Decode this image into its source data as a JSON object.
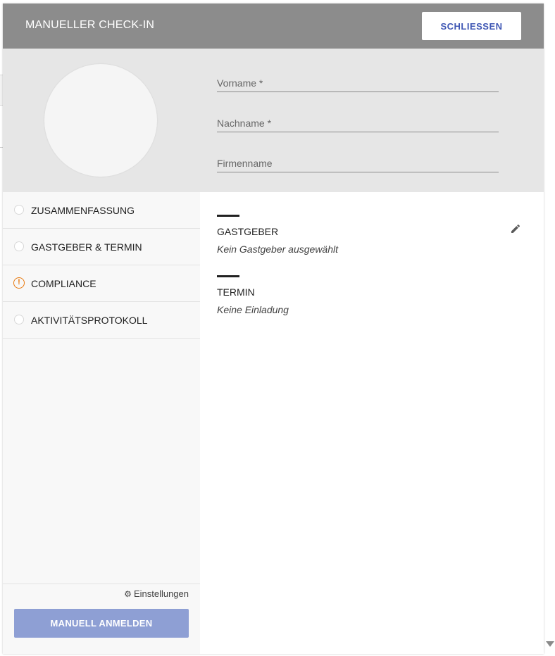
{
  "header": {
    "title": "MANUELLER CHECK-IN",
    "close_label": "SCHLIESSEN"
  },
  "form": {
    "firstname_placeholder": "Vorname *",
    "lastname_placeholder": "Nachname *",
    "company_placeholder": "Firmenname"
  },
  "sidebar": {
    "items": [
      {
        "label": "ZUSAMMENFASSUNG",
        "status": "empty"
      },
      {
        "label": "GASTGEBER & TERMIN",
        "status": "empty"
      },
      {
        "label": "COMPLIANCE",
        "status": "warning"
      },
      {
        "label": "AKTIVITÄTSPROTOKOLL",
        "status": "empty"
      }
    ],
    "settings_label": "Einstellungen",
    "checkin_label": "MANUELL ANMELDEN"
  },
  "summary": {
    "host_title": "GASTGEBER",
    "host_value": "Kein Gastgeber ausgewählt",
    "appointment_title": "TERMIN",
    "appointment_value": "Keine Einladung"
  },
  "colors": {
    "header_bg": "#8c8c8c",
    "accent": "#3f57b4",
    "primary_button": "#8e9fd4",
    "warning": "#e87a10"
  }
}
